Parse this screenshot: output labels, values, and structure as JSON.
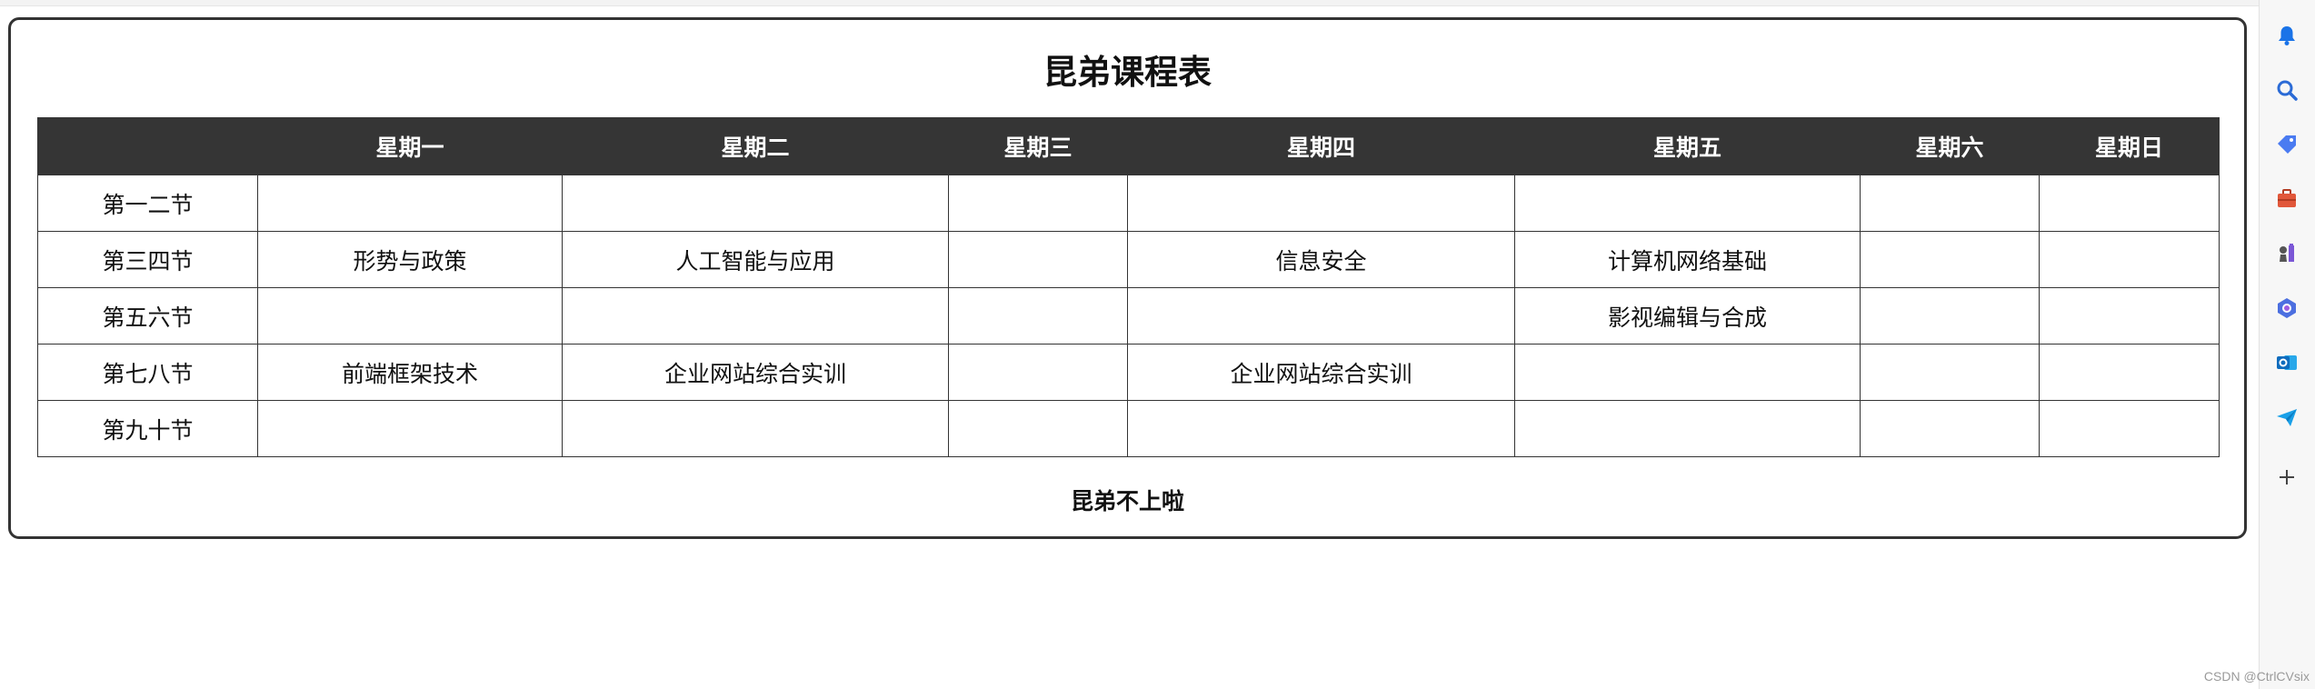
{
  "schedule": {
    "title": "昆弟课程表",
    "headers": [
      "",
      "星期一",
      "星期二",
      "星期三",
      "星期四",
      "星期五",
      "星期六",
      "星期日"
    ],
    "rows": [
      {
        "period": "第一二节",
        "cells": [
          "",
          "",
          "",
          "",
          "",
          "",
          ""
        ]
      },
      {
        "period": "第三四节",
        "cells": [
          "形势与政策",
          "人工智能与应用",
          "",
          "信息安全",
          "计算机网络基础",
          "",
          ""
        ]
      },
      {
        "period": "第五六节",
        "cells": [
          "",
          "",
          "",
          "",
          "影视编辑与合成",
          "",
          ""
        ]
      },
      {
        "period": "第七八节",
        "cells": [
          "前端框架技术",
          "企业网站综合实训",
          "",
          "企业网站综合实训",
          "",
          "",
          ""
        ]
      },
      {
        "period": "第九十节",
        "cells": [
          "",
          "",
          "",
          "",
          "",
          "",
          ""
        ]
      }
    ],
    "footer": "昆弟不上啦"
  },
  "sidebar": {
    "icons": [
      "bell-icon",
      "search-icon",
      "tag-icon",
      "toolbox-icon",
      "chess-icon",
      "copilot-icon",
      "outlook-icon",
      "send-icon",
      "plus-icon"
    ]
  },
  "watermark": "CSDN @CtrlCVsix",
  "colors": {
    "header_bg": "#353535",
    "border": "#333333",
    "bell": "#1a73e8",
    "search": "#2b6bd6",
    "tag": "#4a7bf1",
    "toolbox": "#e1573a",
    "chess": "#7b57d6",
    "copilot": "#4c6fe0",
    "outlook": "#0f6cbd",
    "send": "#1aa0e8"
  }
}
